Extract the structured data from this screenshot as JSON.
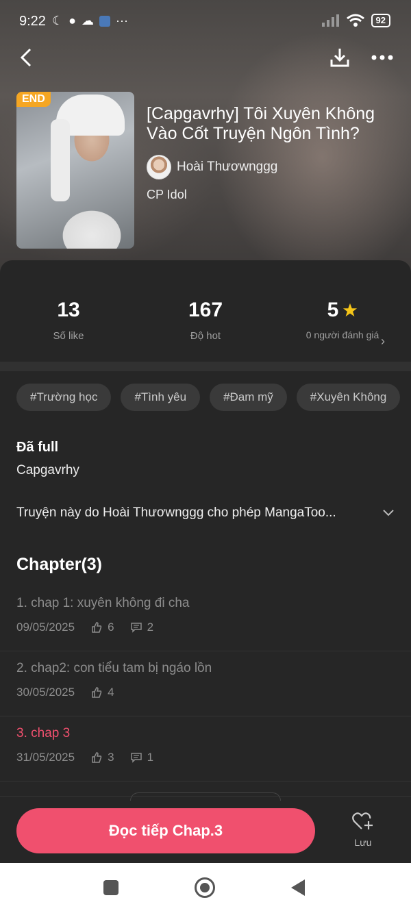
{
  "status_bar": {
    "time": "9:22",
    "battery": "92"
  },
  "header": {
    "badge": "END",
    "title": "[Capgavrhy] Tôi Xuyên Không Vào Cốt Truyện Ngôn Tình?",
    "author": "Hoài Thươwnggg",
    "genre": "CP Idol"
  },
  "stats": {
    "likes": {
      "value": "13",
      "label": "Số like"
    },
    "hot": {
      "value": "167",
      "label": "Độ hot"
    },
    "rating": {
      "value": "5",
      "label": "0 người đánh giá"
    }
  },
  "tags": [
    "#Trường học",
    "#Tình yêu",
    "#Đam mỹ",
    "#Xuyên Không"
  ],
  "info": {
    "status": "Đã full",
    "author": "Capgavrhy",
    "description": "Truyện này do Hoài Thươwnggg cho phép MangaToo..."
  },
  "chapters": {
    "heading": "Chapter(3)",
    "items": [
      {
        "title": "1. chap 1: xuyên không đi cha",
        "date": "09/05/2025",
        "likes": "6",
        "comments": "2"
      },
      {
        "title": "2. chap2: con tiểu tam bị ngáo lồn",
        "date": "30/05/2025",
        "likes": "4"
      },
      {
        "title": "3. chap 3",
        "date": "31/05/2025",
        "likes": "3",
        "comments": "1"
      }
    ]
  },
  "bottom": {
    "read_label": "Đọc tiếp Chap.3",
    "save_label": "Lưu"
  },
  "colors": {
    "accent": "#f0506e",
    "badge": "#f5a623",
    "star": "#f5c518",
    "panel": "#262626"
  }
}
